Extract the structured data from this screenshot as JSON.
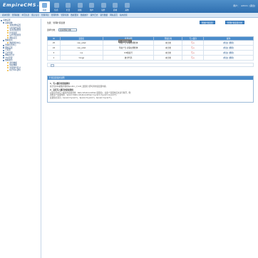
{
  "brand": {
    "logo": "EmpireCMS",
    "version": "7.5"
  },
  "topnav": [
    {
      "label": "系统",
      "active": true
    },
    {
      "label": "信息"
    },
    {
      "label": "栏目"
    },
    {
      "label": "模板"
    },
    {
      "label": "用户"
    },
    {
      "label": "插件"
    },
    {
      "label": "商城"
    },
    {
      "label": "其他"
    }
  ],
  "user": {
    "label": "用户：",
    "name": "admin",
    "logout": "[退出]"
  },
  "subnav": [
    "模块管理",
    "管理模板",
    "单页信息",
    "留言信息",
    "管理评论",
    "管理附件",
    "管理专题",
    "数据更新",
    "数据统计",
    "操作日志",
    "备份数据",
    "网站首页",
    "站内搜索"
  ],
  "sidebar": [
    {
      "label": "系统设置",
      "depth": 0
    },
    {
      "label": "系统参数",
      "depth": 1
    },
    {
      "label": "基本参数设置",
      "depth": 2
    },
    {
      "label": "远程发布设置",
      "depth": 2
    },
    {
      "label": "多访问端管理",
      "depth": 2
    },
    {
      "label": "扩展变量",
      "depth": 2
    },
    {
      "label": "后台导航管理",
      "depth": 2
    },
    {
      "label": "网站首页",
      "depth": 2
    },
    {
      "label": "数据更新",
      "depth": 1
    },
    {
      "label": "数据更新中心",
      "depth": 2
    },
    {
      "label": "管理信息中心",
      "depth": 1
    },
    {
      "label": "网站设置",
      "depth": 1
    },
    {
      "label": "已有区",
      "depth": 1
    },
    {
      "label": "日志管理",
      "depth": 1
    },
    {
      "label": "网站访问计",
      "depth": 1
    },
    {
      "label": "TAG管理",
      "depth": 1
    },
    {
      "label": "数据备份",
      "depth": 1
    },
    {
      "label": "备份数据",
      "depth": 2
    },
    {
      "label": "恢复数据",
      "depth": 2
    },
    {
      "label": "管理备份目录",
      "depth": 2
    },
    {
      "label": "执行SQL语句",
      "depth": 2
    }
  ],
  "page": {
    "crumb": "位置：管理扩展变量",
    "btn_add": "增加扩展变量",
    "btn_manage": "管理扩展变量分类",
    "filter_label": "选择分类：",
    "filter_value": "显示所有分类",
    "tooltip": "[!--系统变量--]"
  },
  "table": {
    "headers": [
      "ID",
      "变量名",
      "变量说明",
      "所属分类",
      "写入缓存",
      "操作"
    ],
    "rows": [
      {
        "id": "25",
        "name": "nav_ads2",
        "desc": "导航广告·对联左侧框体",
        "cat": "未分类",
        "cache": "写入",
        "op": "[修改] [删除]"
      },
      {
        "id": "24",
        "name": "nav_ads1",
        "desc": "导航广告·对联左侧框体",
        "cat": "未分类",
        "cache": "写入",
        "op": "[修改] [删除]"
      },
      {
        "id": "3",
        "name": "icp",
        "desc": "ICP备案号",
        "cat": "未分类",
        "cache": "写入",
        "op": "[修改] [删除]"
      },
      {
        "id": "1",
        "name": "tongji",
        "desc": "统计代码",
        "cat": "未分类",
        "cache": "写入",
        "op": "[修改] [删除]"
      }
    ]
  },
  "info": {
    "title": "扩展变量使用说明",
    "s1": "1、写入缓存的变量调用",
    "s1_text": "在全局CSS模板中调用$public_r['add_变量名']即可调用该变量内容。",
    "s2": "2、没有写入缓存的变量调用",
    "s2_l1": "对没有开启写入缓存的变量调用：ReturnPublicAddVar(变量名)；如多个变量用英文逗号隔开，例：",
    "s2_l2": "调用多个变量内容：$pvar=ReturnPublicAddVar('myvar1,myvar2,myvar3');",
    "s2_l3": "变量值分别为：$pvar['myvar1']、$pvar['myvar2']、$pvar['myvar3']。"
  },
  "colors": {
    "header": "#2f6fb0",
    "table_head": "#4a8ccb"
  }
}
